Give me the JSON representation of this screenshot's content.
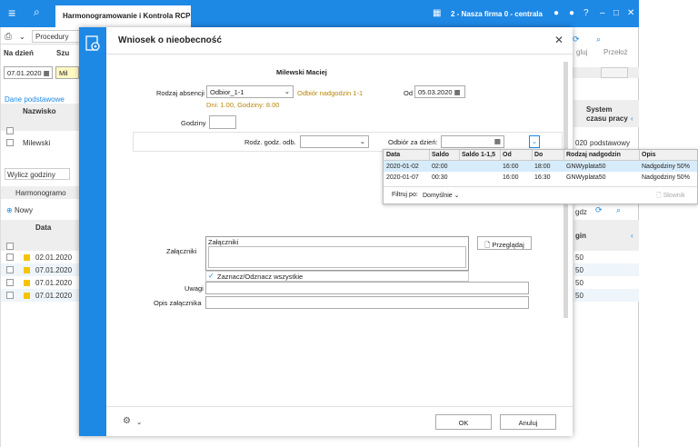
{
  "app": {
    "tab_title": "Harmonogramowanie i Kontrola RCP",
    "company": "2 - Nasza firma 0 - centrala",
    "toolbar": {
      "procedure_label": "Procedury"
    },
    "filter": {
      "na_dzien_label": "Na dzień",
      "na_dzien_value": "07.01.2020",
      "szu_label": "Szu",
      "mil_value": "Mil"
    },
    "right_headers": {
      "col1": "gluj",
      "col2": "Przełoż"
    },
    "section_tab": "Dane podstawowe",
    "grid_headers": {
      "nazwisko": "Nazwisko",
      "system": "System czasu pracy"
    },
    "grid_row": {
      "nazwisko": "Milewski",
      "date_part": "020",
      "system": "podstawowy"
    },
    "wylicz_label": "Wylicz godziny",
    "harm_label": "Harmonogramo",
    "nowy_label": "Nowy",
    "lower_header": {
      "data": "Data",
      "gdz": "gdz",
      "gin": "gin"
    },
    "lower_rows": [
      {
        "data": "02.01.2020",
        "val": "50"
      },
      {
        "data": "07.01.2020",
        "val": "50"
      },
      {
        "data": "07.01.2020",
        "val": "50"
      },
      {
        "data": "07.01.2020",
        "val": "50"
      }
    ]
  },
  "dialog": {
    "title": "Wniosek o nieobecność",
    "employee": "Milewski Maciej",
    "rodzaj_label": "Rodzaj absencji",
    "rodzaj_value": "Odbior_1-1",
    "rodzaj_desc": "Odbiór nadgodzin 1-1",
    "od_label": "Od",
    "od_value": "05.03.2020",
    "dni_text": "Dni: 1.00, Godziny: 8.00",
    "godziny_label": "Godziny",
    "godziny_value": "",
    "rodz_godz_label": "Rodz. godz. odb.",
    "odbior_label": "Odbiór za dzień:",
    "zalaczniki_label": "Załączniki",
    "zalaczniki_box_header": "Załączniki",
    "przegladaj_label": "Przeglądaj",
    "zaznacz_label": "Zaznacz/Odznacz wszystkie",
    "uwagi_label": "Uwagi",
    "opis_label": "Opis załącznika",
    "ok_label": "OK",
    "anuluj_label": "Anuluj"
  },
  "popup": {
    "headers": [
      "Data",
      "Saldo",
      "Saldo 1-1,5",
      "Od",
      "Do",
      "Rodzaj nadgodzin",
      "Opis"
    ],
    "rows": [
      [
        "2020-01-02",
        "02:00",
        "",
        "16:00",
        "18:00",
        "GNWyplata50",
        "Nadgodziny 50%"
      ],
      [
        "2020-01-07",
        "00:30",
        "",
        "16:00",
        "16:30",
        "GNWyplata50",
        "Nadgodziny 50%"
      ]
    ],
    "filter_label": "Filtruj po:",
    "filter_value": "Domyślnie",
    "slownik_label": "Słownik"
  },
  "colors": {
    "accent": "#1e88e5",
    "highlight_row": "#d6ecfb",
    "orange_text": "#b8860b"
  }
}
